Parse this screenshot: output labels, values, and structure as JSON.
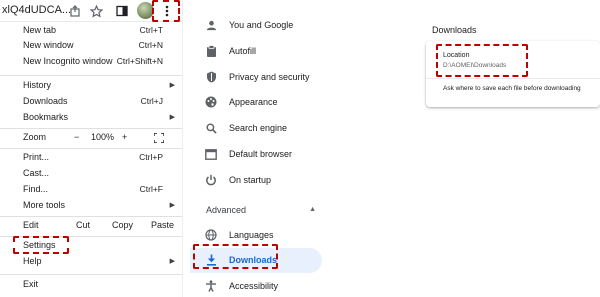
{
  "toolbar": {
    "url_fragment": "xlQ4dUDCA...",
    "icons": [
      "share-icon",
      "star-icon",
      "sidepanel-icon",
      "profile-avatar",
      "more-vert-icon"
    ]
  },
  "menu": {
    "items": {
      "new_tab": {
        "label": "New tab",
        "shortcut": "Ctrl+T"
      },
      "new_window": {
        "label": "New window",
        "shortcut": "Ctrl+N"
      },
      "new_incognito": {
        "label": "New Incognito window",
        "shortcut": "Ctrl+Shift+N"
      },
      "history": {
        "label": "History"
      },
      "downloads": {
        "label": "Downloads",
        "shortcut": "Ctrl+J"
      },
      "bookmarks": {
        "label": "Bookmarks"
      },
      "print": {
        "label": "Print...",
        "shortcut": "Ctrl+P"
      },
      "cast": {
        "label": "Cast..."
      },
      "find": {
        "label": "Find...",
        "shortcut": "Ctrl+F"
      },
      "more_tools": {
        "label": "More tools"
      },
      "settings": {
        "label": "Settings"
      },
      "help": {
        "label": "Help"
      },
      "exit": {
        "label": "Exit"
      }
    },
    "zoom": {
      "label": "Zoom",
      "minus": "−",
      "value": "100%",
      "plus": "+"
    },
    "edit": {
      "label": "Edit",
      "cut": "Cut",
      "copy": "Copy",
      "paste": "Paste"
    }
  },
  "settings_nav": {
    "items": {
      "you_and_google": "You and Google",
      "autofill": "Autofill",
      "privacy": "Privacy and security",
      "appearance": "Appearance",
      "search_engine": "Search engine",
      "default_browser": "Default browser",
      "on_startup": "On startup",
      "languages": "Languages",
      "downloads": "Downloads",
      "accessibility": "Accessibility"
    },
    "advanced": "Advanced",
    "active": "downloads"
  },
  "downloads_page": {
    "heading": "Downloads",
    "location_label": "Location",
    "location_value": "D:\\AOMEI\\Downloads",
    "ask_label": "Ask where to save each file before downloading"
  },
  "colors": {
    "highlight": "#c00000",
    "active_nav_bg": "#e8f0fe",
    "active_nav_text": "#1967d2"
  }
}
